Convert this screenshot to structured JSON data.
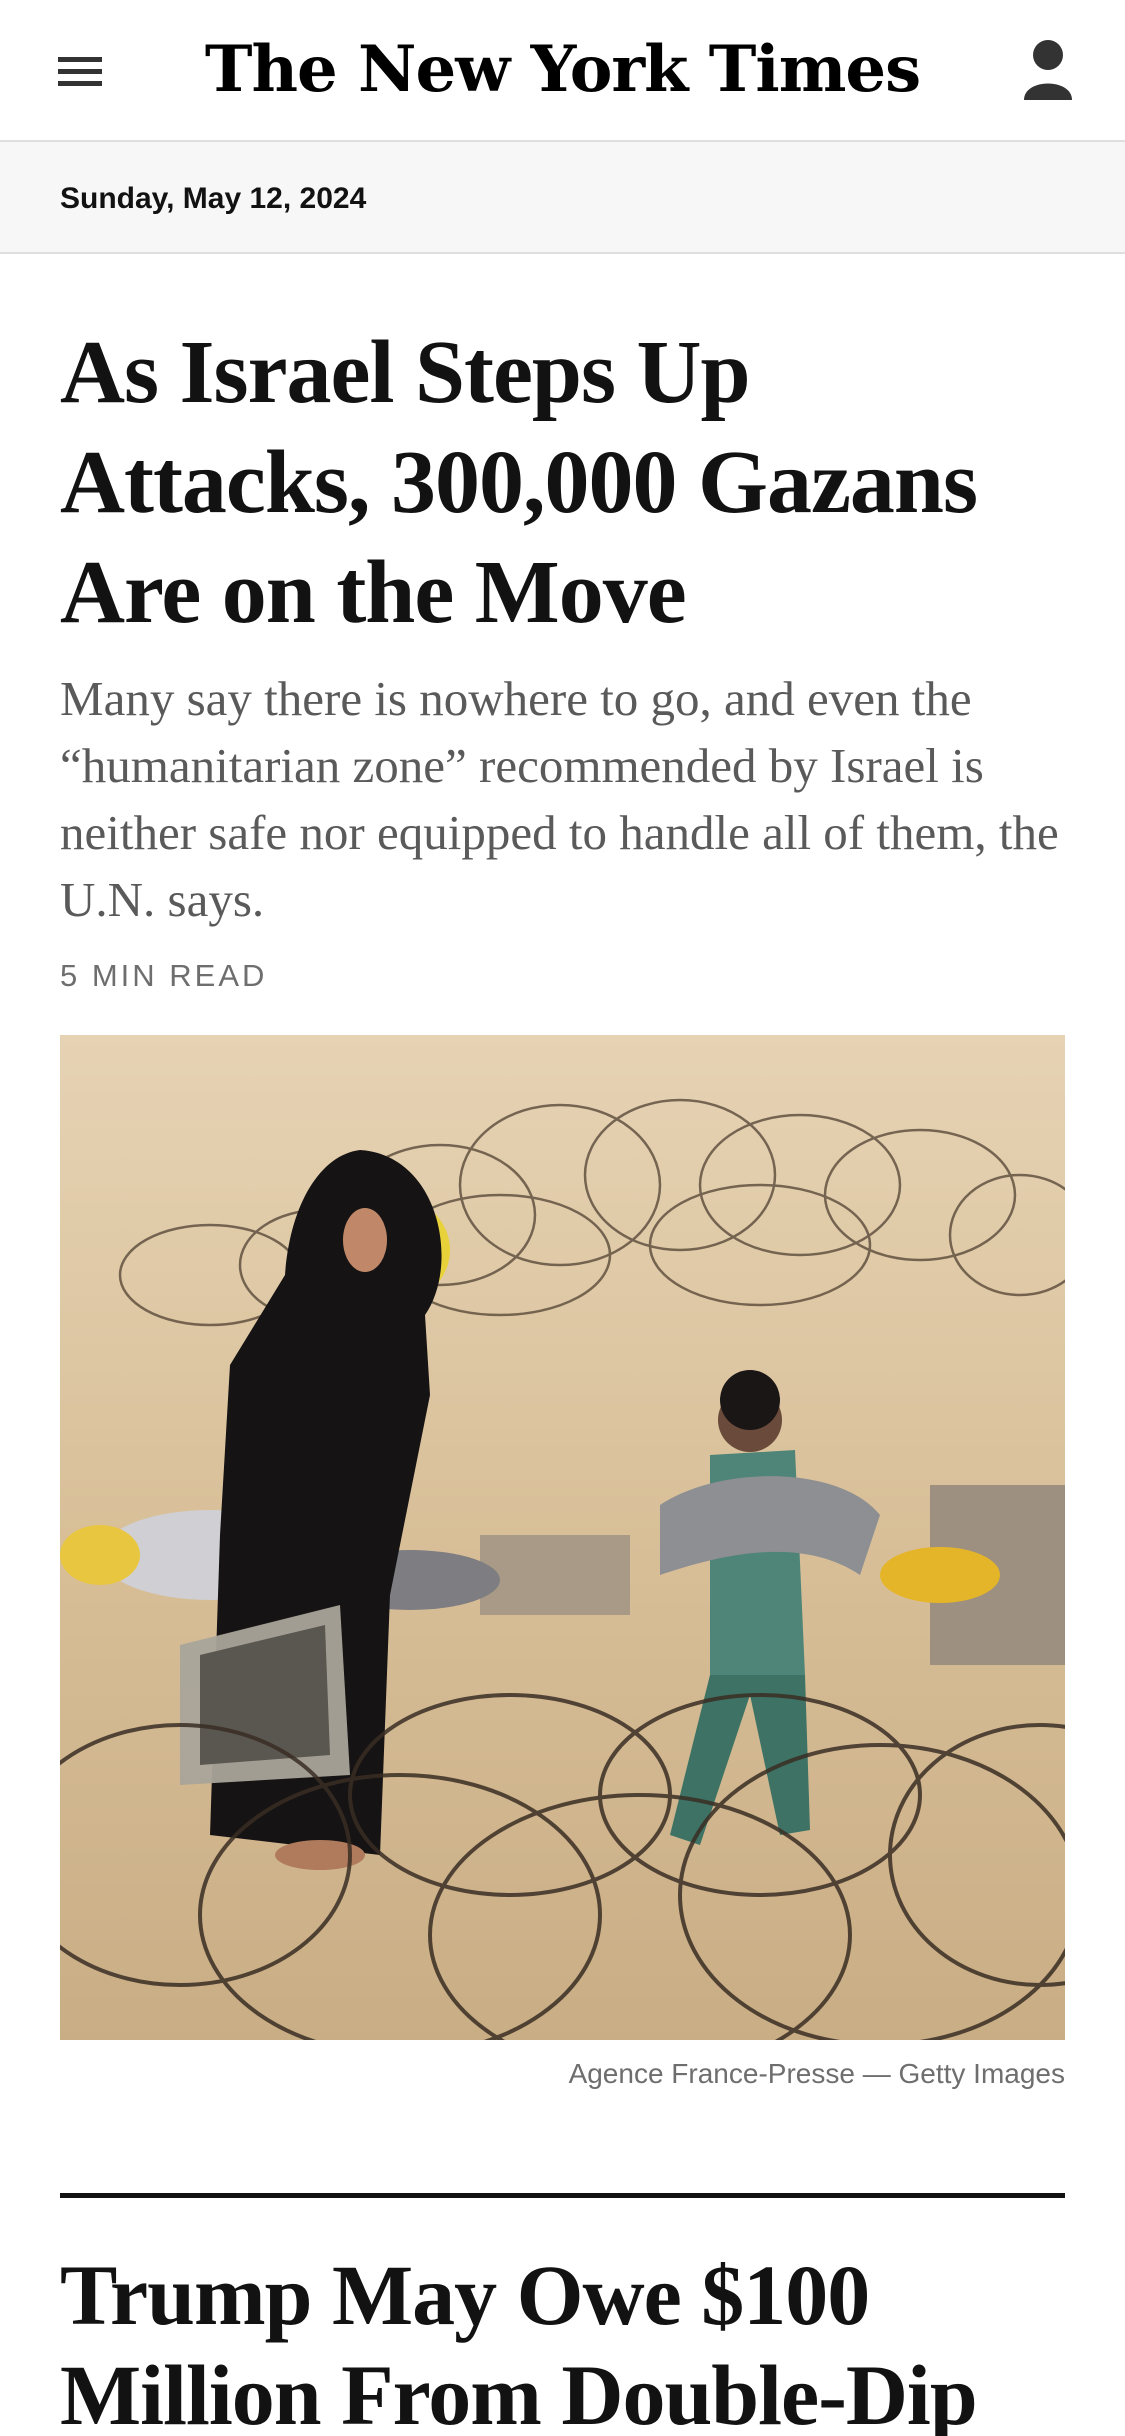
{
  "header": {
    "logo_text": "The New York Times",
    "menu_icon": "hamburger-menu-icon",
    "account_icon": "account-person-icon"
  },
  "date_bar": {
    "date": "Sunday, May 12, 2024"
  },
  "lead_story": {
    "headline": "As Israel Steps Up Attacks, 300,000 Gazans Are on the Move",
    "summary": "Many say there is nowhere to go, and even the “humanitarian zone” recommended by Israel is neither safe nor equipped to handle all of them, the U.N. says.",
    "read_time": "5 MIN READ",
    "image_credit": "Agence France-Presse — Getty Images"
  },
  "next_story": {
    "headline": "Trump May Owe $100 Million From Double-Dip"
  },
  "colors": {
    "text": "#121212",
    "summary_gray": "#5a5a5a",
    "meta_gray": "#6e6e6e",
    "date_bar_bg": "#f7f7f7",
    "border": "#dfdfdf"
  }
}
